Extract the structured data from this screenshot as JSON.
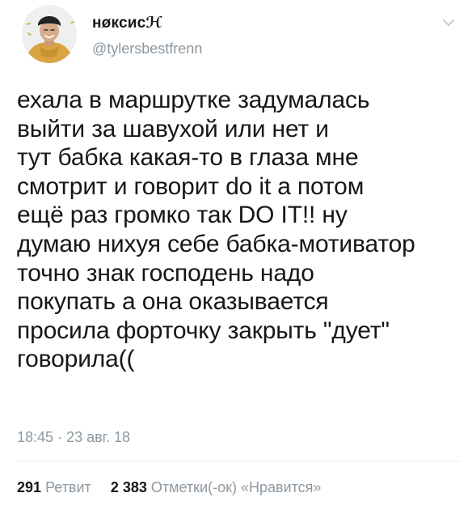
{
  "user": {
    "display_name": "нøксисℋ",
    "handle": "@tylersbestfrenn",
    "avatar_icon": "profile-photo"
  },
  "tweet": {
    "text": "ехала в маршрутке задумалась\nвыйти за шавухой или нет и\nтут бабка какая-то в глаза мне\nсмотрит и говорит do it а потом\nещё раз громко так DO IT!! ну\nдумаю нихуя себе бабка-мотиватор\nточно знак господень надо\nпокупать а она оказывается\nпросила форточку закрыть \"дует\"\nговорила((",
    "time": "18:45",
    "separator": "·",
    "date": "23 авг. 18"
  },
  "stats": {
    "retweets_count": "291",
    "retweets_label": "Ретвит",
    "likes_count": "2 383",
    "likes_label": "Отметки(-ок) «Нравится»"
  },
  "icons": {
    "menu": "chevron-down-icon"
  },
  "colors": {
    "text": "#14171a",
    "secondary": "#8d98a1",
    "divider": "#e1e8ed"
  }
}
